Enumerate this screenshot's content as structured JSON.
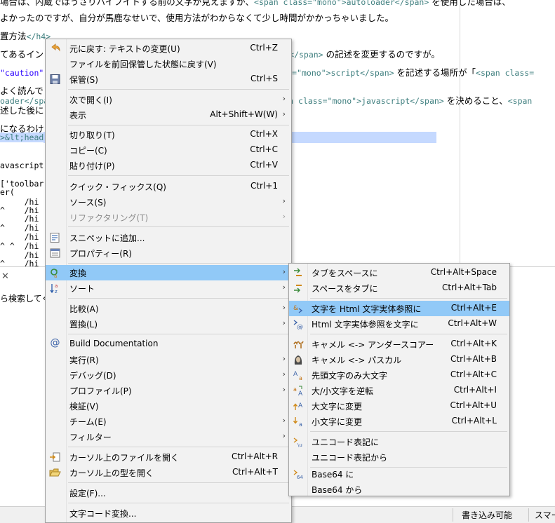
{
  "editor": {
    "line1_a": "場合は、内蔵ではうさりハイフイトする前の文字が見えますが、",
    "line1_tag": "<span class=\"mono\">autoloader</span>",
    "line1_b": " を使用した場合は、",
    "line2": "よかったのですが、自分が馬鹿なせいで、使用方法がわからなくて少し時間がかかっちゃいました。",
    "line3_a": "置方法",
    "line3_tag": "</h4>",
    "line4_a": "てあるイン",
    "line4_tag": "</span>",
    "line4_b": " の記述を変更するのですが。",
    "line5_a": "\"caution\"",
    "line5_tag": "ss=\"mono\">script</span>",
    "line5_b": " を記述する場所が「",
    "line5_tag2": "<span class=",
    "line6": "よく読んで",
    "line7_a": "oader</spa",
    "line7_tag": "an class=\"mono\">javascript</span>",
    "line7_b": " を決めること、",
    "line7_tag2": "<span",
    "line8": "述した後に",
    "line9": "になるわけ",
    "line10_sel": ">&lt;head",
    "line11": "avascript",
    "line12": "['toolbar",
    "line13": "er(",
    "line14": "     /hi",
    "line15": "^    /hi",
    "line16": "     /hi",
    "line17": "^    /hi",
    "line18": "     /hi",
    "line19": "^ ^  /hi",
    "line20": "     /hi",
    "line21": "^    /hi"
  },
  "bottom_panel": {
    "close_glyph": "✕",
    "search_text": "ら検索してくだ"
  },
  "status": {
    "writable": "書き込み可能",
    "insert_mode": "スマー"
  },
  "context_menu": {
    "items": [
      {
        "label": "元に戻す: テキストの変更(U)",
        "shortcut": "Ctrl+Z",
        "icon": "undo-icon"
      },
      {
        "label": "ファイルを前回保管した状態に戻す(V)",
        "shortcut": ""
      },
      {
        "label": "保管(S)",
        "shortcut": "Ctrl+S",
        "icon": "save-icon"
      },
      {
        "label": "次で開く(I)",
        "shortcut": ""
      },
      {
        "label": "表示",
        "shortcut": "Alt+Shift+W(W)"
      },
      {
        "label": "切り取り(T)",
        "shortcut": "Ctrl+X"
      },
      {
        "label": "コピー(C)",
        "shortcut": "Ctrl+C"
      },
      {
        "label": "貼り付け(P)",
        "shortcut": "Ctrl+V"
      },
      {
        "label": "クイック・フィックス(Q)",
        "shortcut": "Ctrl+1"
      },
      {
        "label": "ソース(S)",
        "shortcut": ""
      },
      {
        "label": "リファクタリング(T)",
        "shortcut": "",
        "disabled": true
      },
      {
        "label": "スニペットに追加...",
        "shortcut": "",
        "icon": "snippet-icon"
      },
      {
        "label": "プロパティー(R)",
        "shortcut": "",
        "icon": "properties-icon"
      },
      {
        "label": "変換",
        "shortcut": "",
        "icon": "convert-icon"
      },
      {
        "label": "ソート",
        "shortcut": "",
        "icon": "sort-icon"
      },
      {
        "label": "比較(A)",
        "shortcut": ""
      },
      {
        "label": "置換(L)",
        "shortcut": ""
      },
      {
        "label": "Build Documentation",
        "shortcut": "",
        "icon": "at-icon"
      },
      {
        "label": "実行(R)",
        "shortcut": ""
      },
      {
        "label": "デバッグ(D)",
        "shortcut": ""
      },
      {
        "label": "プロファイル(P)",
        "shortcut": ""
      },
      {
        "label": "検証(V)",
        "shortcut": ""
      },
      {
        "label": "チーム(E)",
        "shortcut": ""
      },
      {
        "label": "フィルター",
        "shortcut": ""
      },
      {
        "label": "カーソル上のファイルを開く",
        "shortcut": "Ctrl+Alt+R",
        "icon": "open-file-icon"
      },
      {
        "label": "カーソル上の型を開く",
        "shortcut": "Ctrl+Alt+T",
        "icon": "open-type-icon"
      },
      {
        "label": "設定(F)...",
        "shortcut": ""
      },
      {
        "label": "文字コード変換...",
        "shortcut": ""
      }
    ]
  },
  "convert_submenu": {
    "items": [
      {
        "label": "タブをスペースに",
        "shortcut": "Ctrl+Alt+Space"
      },
      {
        "label": "スペースをタブに",
        "shortcut": "Ctrl+Alt+Tab"
      },
      {
        "label": "文字を Html 文字実体参照に",
        "shortcut": "Ctrl+Alt+E"
      },
      {
        "label": "Html 文字実体参照を文字に",
        "shortcut": "Ctrl+Alt+W"
      },
      {
        "label": "キャメル <-> アンダースコアー",
        "shortcut": "Ctrl+Alt+K"
      },
      {
        "label": "キャメル <-> パスカル",
        "shortcut": "Ctrl+Alt+B"
      },
      {
        "label": "先頭文字のみ大文字",
        "shortcut": "Ctrl+Alt+C"
      },
      {
        "label": "大/小文字を逆転",
        "shortcut": "Ctrl+Alt+I"
      },
      {
        "label": "大文字に変更",
        "shortcut": "Ctrl+Alt+U"
      },
      {
        "label": "小文字に変更",
        "shortcut": "Ctrl+Alt+L"
      },
      {
        "label": "ユニコード表記に",
        "shortcut": ""
      },
      {
        "label": "ユニコード表記から",
        "shortcut": ""
      },
      {
        "label": "Base64 に",
        "shortcut": ""
      },
      {
        "label": "Base64 から",
        "shortcut": ""
      }
    ]
  },
  "colors": {
    "highlight": "#91c9f7",
    "menu_bg": "#f2f2f2",
    "selection": "#c5d9ff"
  }
}
